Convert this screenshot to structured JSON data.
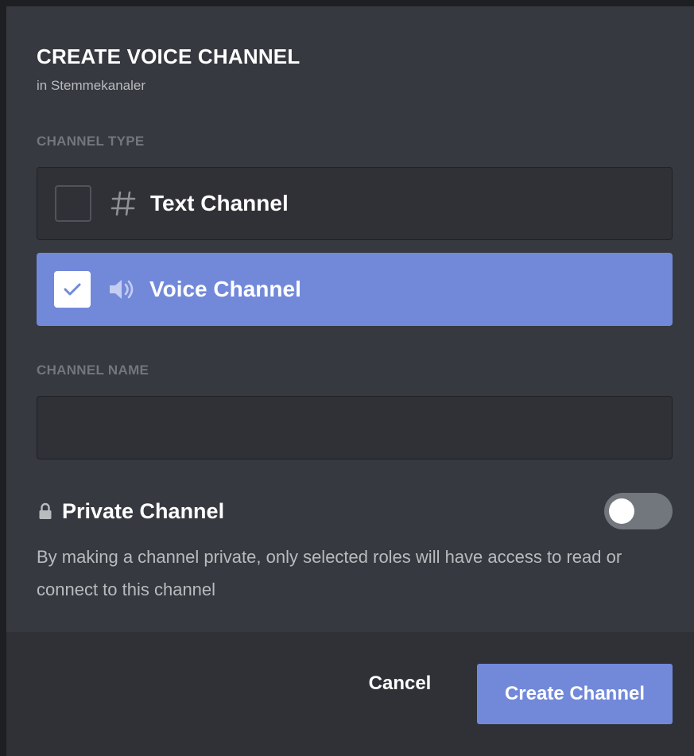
{
  "modal": {
    "title": "CREATE VOICE CHANNEL",
    "subtitle": "in Stemmekanaler"
  },
  "channel_type": {
    "label": "CHANNEL TYPE",
    "options": [
      {
        "label": "Text Channel",
        "icon": "hash-icon",
        "checked": false
      },
      {
        "label": "Voice Channel",
        "icon": "speaker-icon",
        "checked": true
      }
    ]
  },
  "channel_name": {
    "label": "CHANNEL NAME",
    "value": "",
    "placeholder": ""
  },
  "private": {
    "label": "Private Channel",
    "enabled": false,
    "description": "By making a channel private, only selected roles will have access to read or connect to this channel"
  },
  "footer": {
    "cancel_label": "Cancel",
    "create_label": "Create Channel"
  },
  "colors": {
    "accent": "#7289da",
    "background": "#36393f",
    "footer": "#2f3136"
  }
}
